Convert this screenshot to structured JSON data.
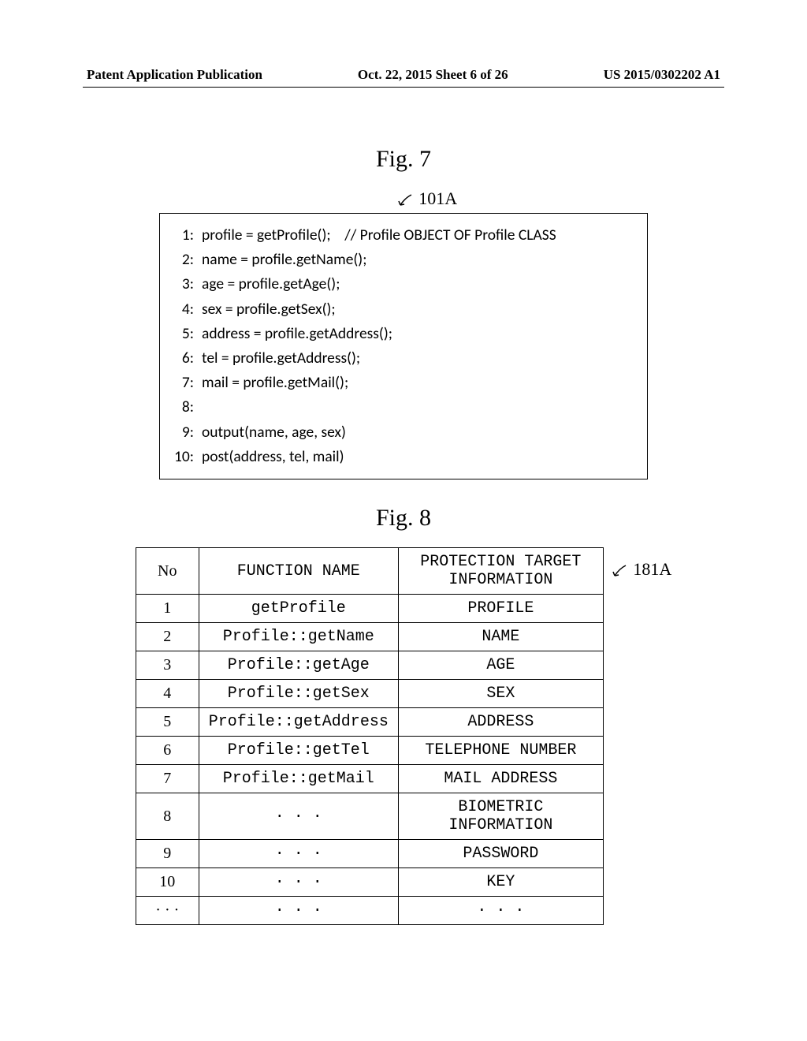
{
  "header": {
    "left": "Patent Application Publication",
    "center": "Oct. 22, 2015   Sheet 6 of 26",
    "right": "US 2015/0302202 A1"
  },
  "fig7": {
    "title": "Fig. 7",
    "ref_label": "101A",
    "code_lines": [
      {
        "num": "1:",
        "text": "profile = getProfile();    // Profile OBJECT OF Profile CLASS"
      },
      {
        "num": "2:",
        "text": "name = profile.getName();"
      },
      {
        "num": "3:",
        "text": "age = profile.getAge();"
      },
      {
        "num": "4:",
        "text": "sex = profile.getSex();"
      },
      {
        "num": "5:",
        "text": "address = profile.getAddress();"
      },
      {
        "num": "6:",
        "text": "tel = profile.getAddress();"
      },
      {
        "num": "7:",
        "text": "mail = profile.getMail();"
      },
      {
        "num": "8:",
        "text": ""
      },
      {
        "num": "9:",
        "text": "output(name, age, sex)"
      },
      {
        "num": "10:",
        "text": "post(address, tel, mail)"
      }
    ]
  },
  "fig8": {
    "title": "Fig. 8",
    "ref_label": "181A",
    "headers": {
      "no": "No",
      "func": "FUNCTION NAME",
      "target": "PROTECTION TARGET INFORMATION"
    },
    "rows": [
      {
        "no": "1",
        "func": "getProfile",
        "target": "PROFILE"
      },
      {
        "no": "2",
        "func": "Profile::getName",
        "target": "NAME"
      },
      {
        "no": "3",
        "func": "Profile::getAge",
        "target": "AGE"
      },
      {
        "no": "4",
        "func": "Profile::getSex",
        "target": "SEX"
      },
      {
        "no": "5",
        "func": "Profile::getAddress",
        "target": "ADDRESS"
      },
      {
        "no": "6",
        "func": "Profile::getTel",
        "target": "TELEPHONE NUMBER"
      },
      {
        "no": "7",
        "func": "Profile::getMail",
        "target": "MAIL ADDRESS"
      },
      {
        "no": "8",
        "func": "· · ·",
        "target": "BIOMETRIC INFORMATION"
      },
      {
        "no": "9",
        "func": "· · ·",
        "target": "PASSWORD"
      },
      {
        "no": "10",
        "func": "· · ·",
        "target": "KEY"
      },
      {
        "no": "· · ·",
        "func": "· · ·",
        "target": "· · ·"
      }
    ]
  }
}
